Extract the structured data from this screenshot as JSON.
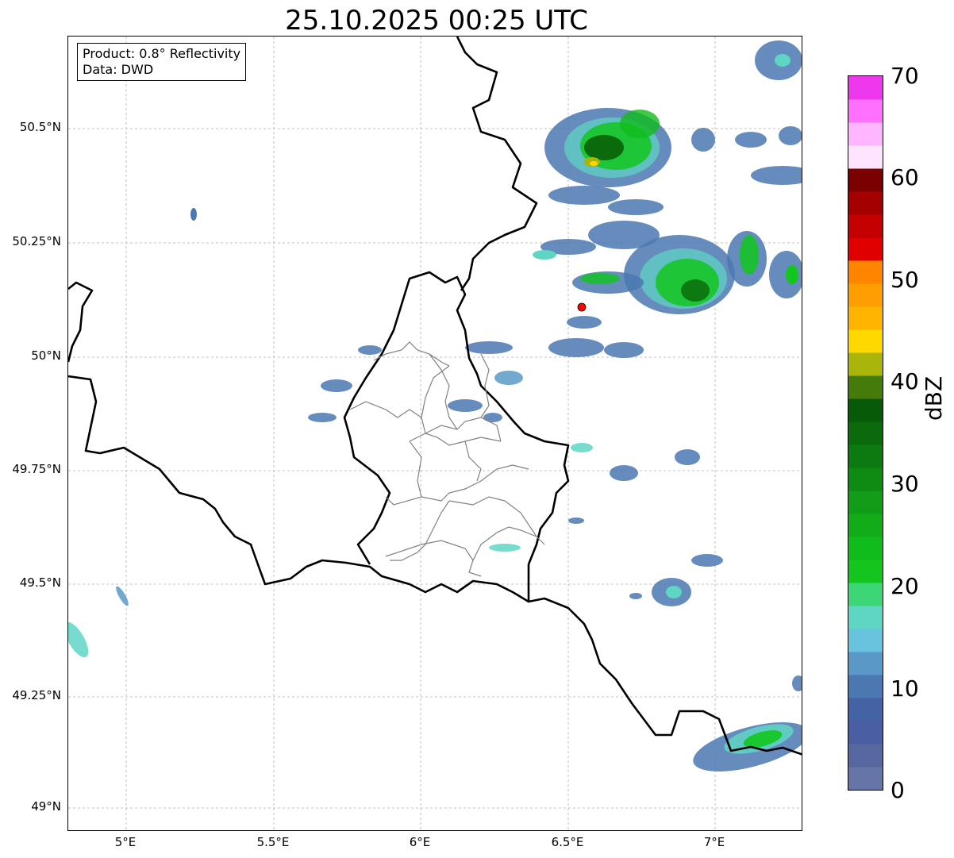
{
  "title": "25.10.2025 00:25 UTC",
  "info": {
    "product": "Product: 0.8° Reflectivity",
    "data": "Data: DWD"
  },
  "axes": {
    "x_ticks": [
      "5°E",
      "5.5°E",
      "6°E",
      "6.5°E",
      "7°E"
    ],
    "y_ticks": [
      "50.5°N",
      "50.25°N",
      "50°N",
      "49.75°N",
      "49.5°N",
      "49.25°N",
      "49°N"
    ],
    "x_range": [
      4.8,
      7.3
    ],
    "y_range": [
      48.95,
      50.7
    ]
  },
  "colorbar": {
    "label": "dBZ",
    "ticks": [
      "0",
      "10",
      "20",
      "30",
      "40",
      "50",
      "60",
      "70"
    ],
    "colors": [
      "#6575a8",
      "#56689f",
      "#4a5fa3",
      "#4463a4",
      "#4b78b1",
      "#5a99c7",
      "#67c3de",
      "#5fd5c4",
      "#3cd677",
      "#12c61e",
      "#10bb1c",
      "#11ac18",
      "#129d19",
      "#0f8b14",
      "#0c7a11",
      "#0a6a0c",
      "#075a08",
      "#457b0b",
      "#aab50b",
      "#ffd800",
      "#ffb400",
      "#ff9e00",
      "#ff8500",
      "#e00000",
      "#c50000",
      "#a50000",
      "#7b0000",
      "#ffe4ff",
      "#ffb6ff",
      "#ff70ff",
      "#ee38ee"
    ]
  },
  "radar_site": {
    "lon": 6.55,
    "lat": 50.11,
    "color": "#ff0000"
  },
  "layers": {
    "country_border_color": "#000000",
    "district_border_color": "#808080",
    "grid_color": "#b0b0b0"
  }
}
